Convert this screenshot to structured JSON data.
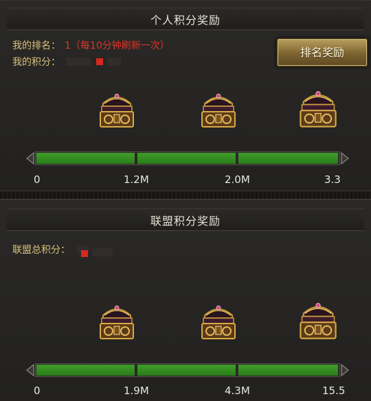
{
  "personal": {
    "title": "个人积分奖励",
    "rank_label": "我的排名：",
    "rank_value": "1（每10分钟刷新一次）",
    "points_label": "我的积分：",
    "rank_button": "排名奖励",
    "ticks": [
      "0",
      "1.2M",
      "2.0M",
      "3.3"
    ],
    "progress": 1.0
  },
  "alliance": {
    "title": "联盟积分奖励",
    "points_label": "联盟总积分：",
    "ticks": [
      "0",
      "1.9M",
      "4.3M",
      "15.5"
    ],
    "progress": 1.0
  },
  "icons": {
    "chest": "treasure-chest-icon",
    "left_arrow": "arrow-left-icon",
    "right_arrow": "arrow-right-icon"
  },
  "colors": {
    "progress_fill": "#3a9628",
    "label_gold": "#d8c07a",
    "value_red": "#e0352a"
  }
}
